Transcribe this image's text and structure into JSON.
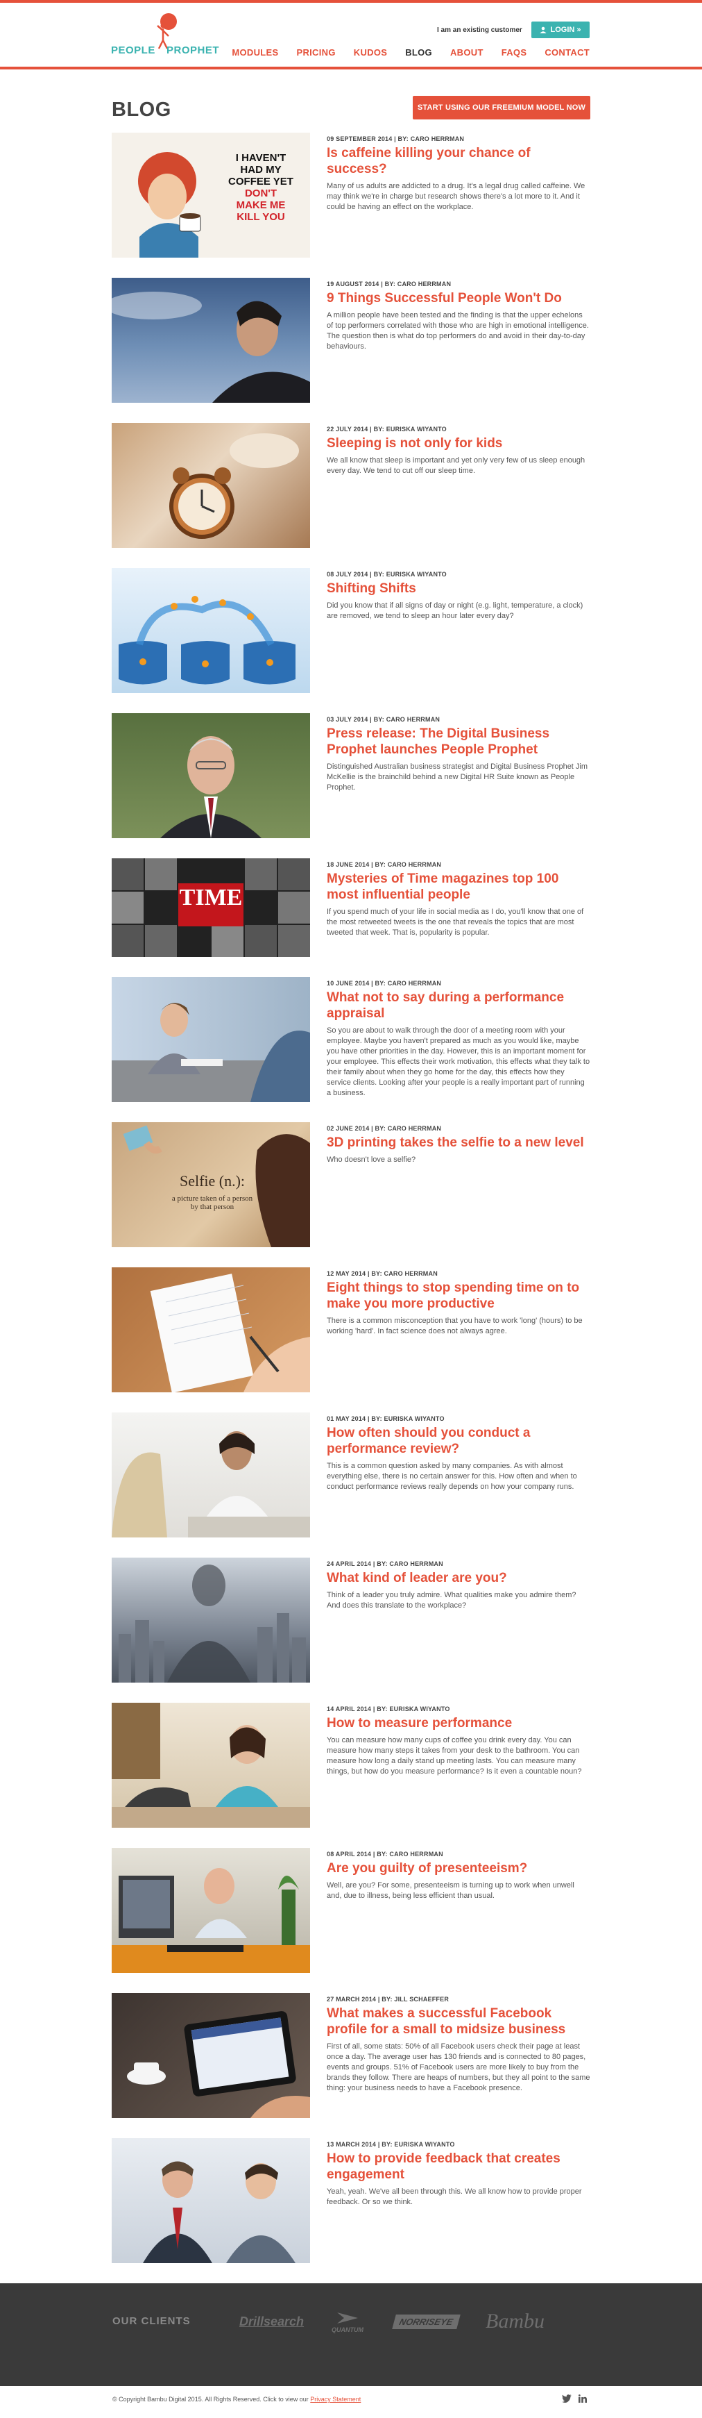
{
  "header": {
    "logo_word1": "PEOPLE",
    "logo_word2": "PROPHET",
    "existing_customer": "I am an existing customer",
    "login_label": "LOGIN »",
    "nav": [
      "MODULES",
      "PRICING",
      "KUDOS",
      "BLOG",
      "ABOUT",
      "FAQS",
      "CONTACT"
    ],
    "active_nav": "BLOG"
  },
  "page": {
    "title": "BLOG",
    "cta_label": "START USING OUR FREEMIUM MODEL NOW"
  },
  "posts": [
    {
      "meta": "09 SEPTEMBER 2014 | BY: CARO HERRMAN",
      "title": "Is caffeine killing your chance of success?",
      "excerpt": "Many of us adults are addicted to a drug. It's a legal drug called caffeine. We may think we're in charge but research shows there's a lot more to it. And it could be having an effect on the workplace.",
      "image_text": [
        "I HAVEN'T",
        "HAD MY",
        "COFFEE YET",
        "DON'T",
        "MAKE ME",
        "KILL YOU"
      ]
    },
    {
      "meta": "19 AUGUST 2014 | BY: CARO HERRMAN",
      "title": "9 Things Successful People Won't Do",
      "excerpt": "A million people have been tested and the finding is that the upper echelons of top performers correlated with those who are high in emotional intelligence. The question then is what do top performers do and avoid in their day-to-day behaviours."
    },
    {
      "meta": "22 JULY 2014 | BY: EURISKA WIYANTO",
      "title": "Sleeping is not only for kids",
      "excerpt": "We all know that sleep is important and yet only very few of us sleep enough every day. We tend to cut off our sleep time."
    },
    {
      "meta": "08 JULY 2014 | BY: EURISKA WIYANTO",
      "title": "Shifting Shifts",
      "excerpt": "Did you know that if all signs of day or night (e.g. light, temperature, a clock) are removed, we tend to sleep an hour later every day?"
    },
    {
      "meta": "03 JULY 2014 | BY: CARO HERRMAN",
      "title": "Press release: The Digital Business Prophet launches People Prophet",
      "excerpt": "Distinguished Australian business strategist and Digital Business Prophet Jim McKellie is the brainchild behind a new Digital HR Suite known as People Prophet."
    },
    {
      "meta": "18 JUNE 2014 | BY: CARO HERRMAN",
      "title": "Mysteries of Time magazines top 100 most influential people",
      "excerpt": "If you spend much of your life in social media as I do, you'll know that one of the most retweeted tweets is the one that reveals the topics that are most tweeted that week. That is, popularity is popular.",
      "image_text": [
        "TIME"
      ]
    },
    {
      "meta": "10 JUNE 2014 | BY: CARO HERRMAN",
      "title": "What not to say during a performance appraisal",
      "excerpt": "So you are about to walk through the door of a meeting room with your employee. Maybe you haven't prepared as much as you would like, maybe you have other priorities in the day. However, this is an important moment for your employee. This effects their work motivation, this effects what they talk to their family about when they go home for the day, this effects how they service clients. Looking after your people is a really important part of running a business."
    },
    {
      "meta": "02 JUNE 2014 | BY: CARO HERRMAN",
      "title": "3D printing takes the selfie to a new level",
      "excerpt": "Who doesn't love a selfie?",
      "image_text": [
        "Selfie (n.):",
        "a picture taken of a person",
        "by that person"
      ]
    },
    {
      "meta": "12 MAY 2014 | BY: CARO HERRMAN",
      "title": "Eight things to stop spending time on to make you more productive",
      "excerpt": "There is a common misconception that you have to work 'long' (hours) to be working 'hard'. In fact science does not always agree."
    },
    {
      "meta": "01 MAY 2014 | BY: EURISKA WIYANTO",
      "title": "How often should you conduct a performance review?",
      "excerpt": "This is a common question asked by many companies. As with almost everything else, there is no certain answer for this. How often and when to conduct performance reviews really depends on how your company runs."
    },
    {
      "meta": "24 APRIL 2014 | BY: CARO HERRMAN",
      "title": "What kind of leader are you?",
      "excerpt": "Think of a leader you truly admire. What qualities make you admire them? And does this translate to the workplace?"
    },
    {
      "meta": "14 APRIL 2014 | BY: EURISKA WIYANTO",
      "title": "How to measure performance",
      "excerpt": "You can measure how many cups of coffee you drink every day. You can measure how many steps it takes from your desk to the bathroom. You can measure how long a daily stand up meeting lasts. You can measure many things, but how do you measure performance? Is it even a countable noun?"
    },
    {
      "meta": "08 APRIL 2014 | BY: CARO HERRMAN",
      "title": "Are you guilty of presenteeism?",
      "excerpt": "Well, are you? For some, presenteeism is turning up to work when unwell and, due to illness, being less efficient than usual."
    },
    {
      "meta": "27 MARCH 2014 | BY: JILL SCHAEFFER",
      "title": "What makes a successful Facebook profile for a small to midsize business",
      "excerpt": "First of all, some stats: 50% of all Facebook users check their page at least once a day. The average user has 130 friends and is connected to 80 pages, events and groups. 51% of Facebook users are more likely to buy from the brands they follow. There are heaps of numbers, but they all point to the same thing: your business needs to have a Facebook presence."
    },
    {
      "meta": "13 MARCH 2014 | BY: EURISKA WIYANTO",
      "title": "How to provide feedback that creates engagement",
      "excerpt": "Yeah, yeah. We've all been through this. We all know how to provide proper feedback. Or so we think."
    }
  ],
  "footer": {
    "clients_label": "OUR CLIENTS",
    "clients": [
      "Drillsearch",
      "QUANTUM",
      "NORRISEYE",
      "Bambu"
    ],
    "copyright": "© Copyright Bambu Digital 2015. All Rights Reserved. Click to view our",
    "privacy_link": "Privacy Statement",
    "social": [
      "twitter-icon",
      "linkedin-icon"
    ]
  },
  "colors": {
    "accent": "#e5513a",
    "teal": "#3bb3b0",
    "footer_bg": "#3a3a3a"
  }
}
